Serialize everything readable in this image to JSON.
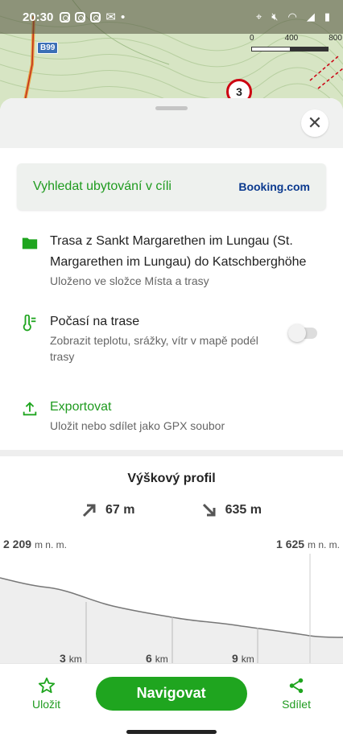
{
  "status_bar": {
    "time": "20:30"
  },
  "map": {
    "road_label": "B99",
    "marker_number": "3",
    "scale_ticks": [
      "0",
      "400",
      "800"
    ],
    "scale_unit": "m"
  },
  "booking": {
    "text": "Vyhledat ubytování v cíli",
    "brand": "Booking.com"
  },
  "route": {
    "title": "Trasa z Sankt Margarethen im Lungau (St. Margarethen im Lungau) do Katschberghöhe",
    "subtitle": "Uloženo ve složce Místa a trasy"
  },
  "weather": {
    "title": "Počasí na trase",
    "subtitle": "Zobrazit teplotu, srážky, vítr v mapě podél trasy",
    "toggle_on": false
  },
  "export": {
    "title": "Exportovat",
    "subtitle": "Uložit nebo sdílet jako GPX soubor"
  },
  "elevation": {
    "title": "Výškový profil",
    "ascent": "67 m",
    "descent": "635 m",
    "start_value": "2 209",
    "start_unit": "m n. m.",
    "end_value": "1 625",
    "end_unit": "m n. m.",
    "km_ticks": [
      {
        "value": "3",
        "unit": "km"
      },
      {
        "value": "6",
        "unit": "km"
      },
      {
        "value": "9",
        "unit": "km"
      }
    ]
  },
  "bottom_bar": {
    "save_label": "Uložit",
    "navigate_label": "Navigovat",
    "share_label": "Sdílet"
  },
  "colors": {
    "accent": "#1fa51f",
    "booking_brand": "#0b3a8f"
  }
}
